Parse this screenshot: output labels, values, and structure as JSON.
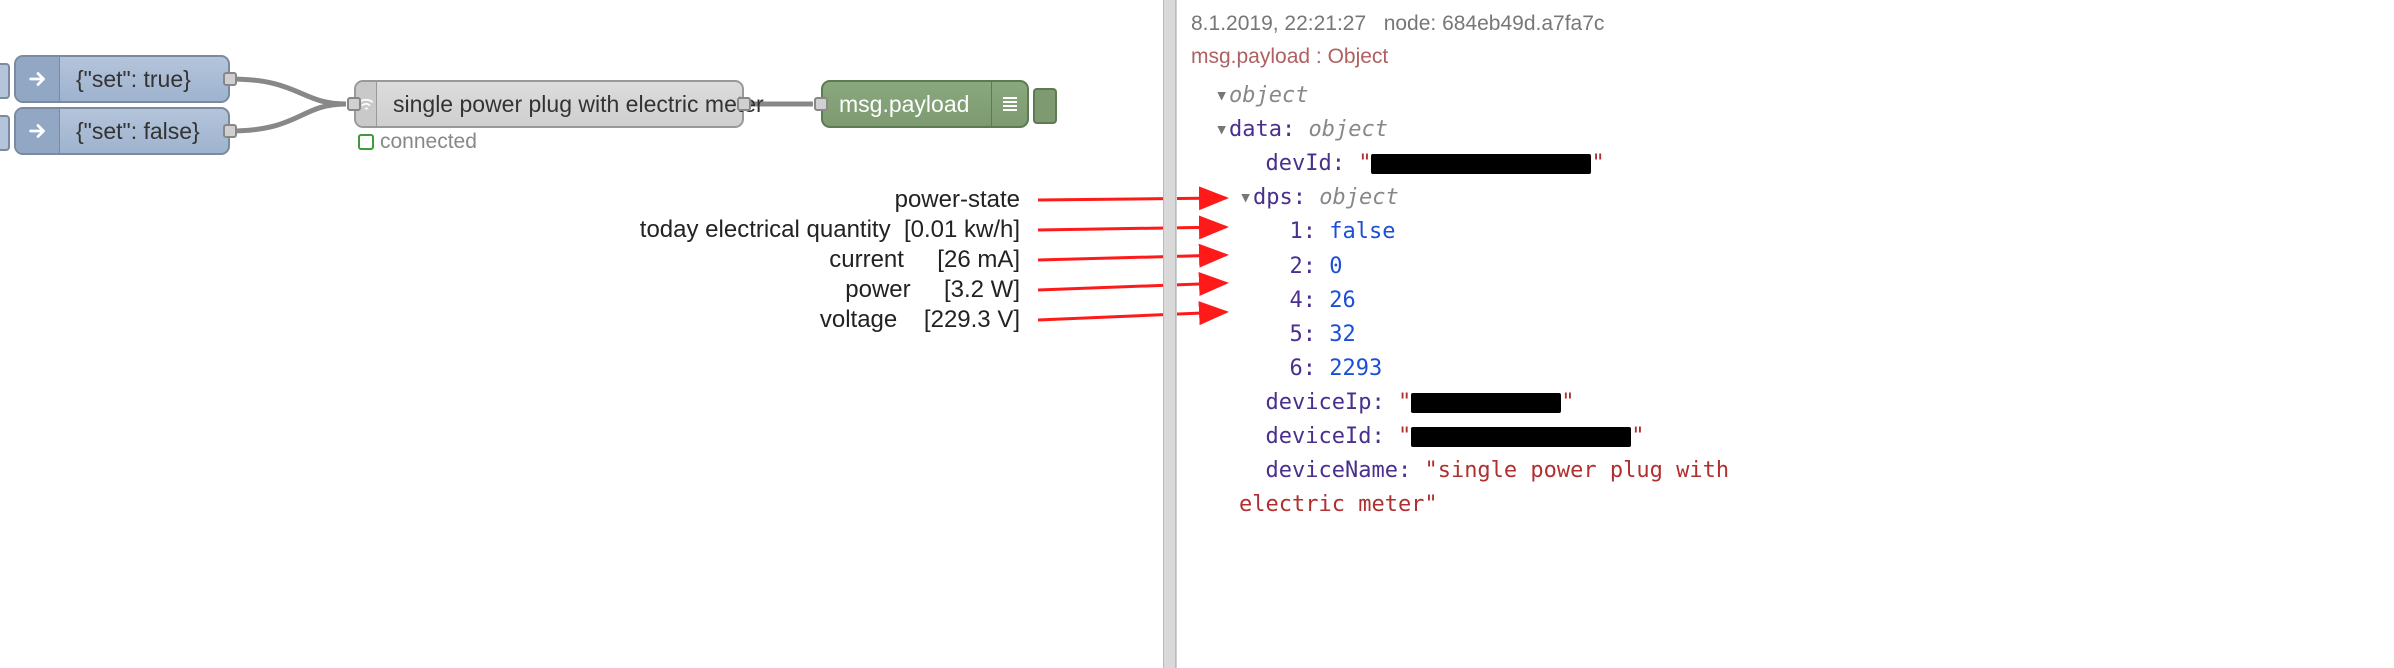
{
  "inject_nodes": [
    {
      "label": "{\"set\": true}"
    },
    {
      "label": "{\"set\": false}"
    }
  ],
  "device_node": {
    "label": "single power plug with electric meter",
    "status": "connected"
  },
  "debug_node": {
    "label": "msg.payload"
  },
  "annotations": [
    {
      "label": "power-state",
      "unit": ""
    },
    {
      "label": "today electrical quantity",
      "unit": "[0.01 kw/h]"
    },
    {
      "label": "current",
      "unit": "[26 mA]"
    },
    {
      "label": "power",
      "unit": "[3.2 W]"
    },
    {
      "label": "voltage",
      "unit": "[229.3 V]"
    }
  ],
  "debug_panel": {
    "timestamp": "8.1.2019, 22:21:27",
    "node_id": "node: 684eb49d.a7fa7c",
    "topic": "msg.payload : Object",
    "root_type": "object",
    "data_label": "data:",
    "data_type": "object",
    "devId_key": "devId:",
    "dps_label": "dps:",
    "dps_type": "object",
    "dps": {
      "1": "false",
      "2": "0",
      "4": "26",
      "5": "32",
      "6": "2293"
    },
    "deviceIp_key": "deviceIp:",
    "deviceId_key": "deviceId:",
    "deviceName_key": "deviceName:",
    "deviceName_val": "\"single power plug with electric meter\""
  }
}
